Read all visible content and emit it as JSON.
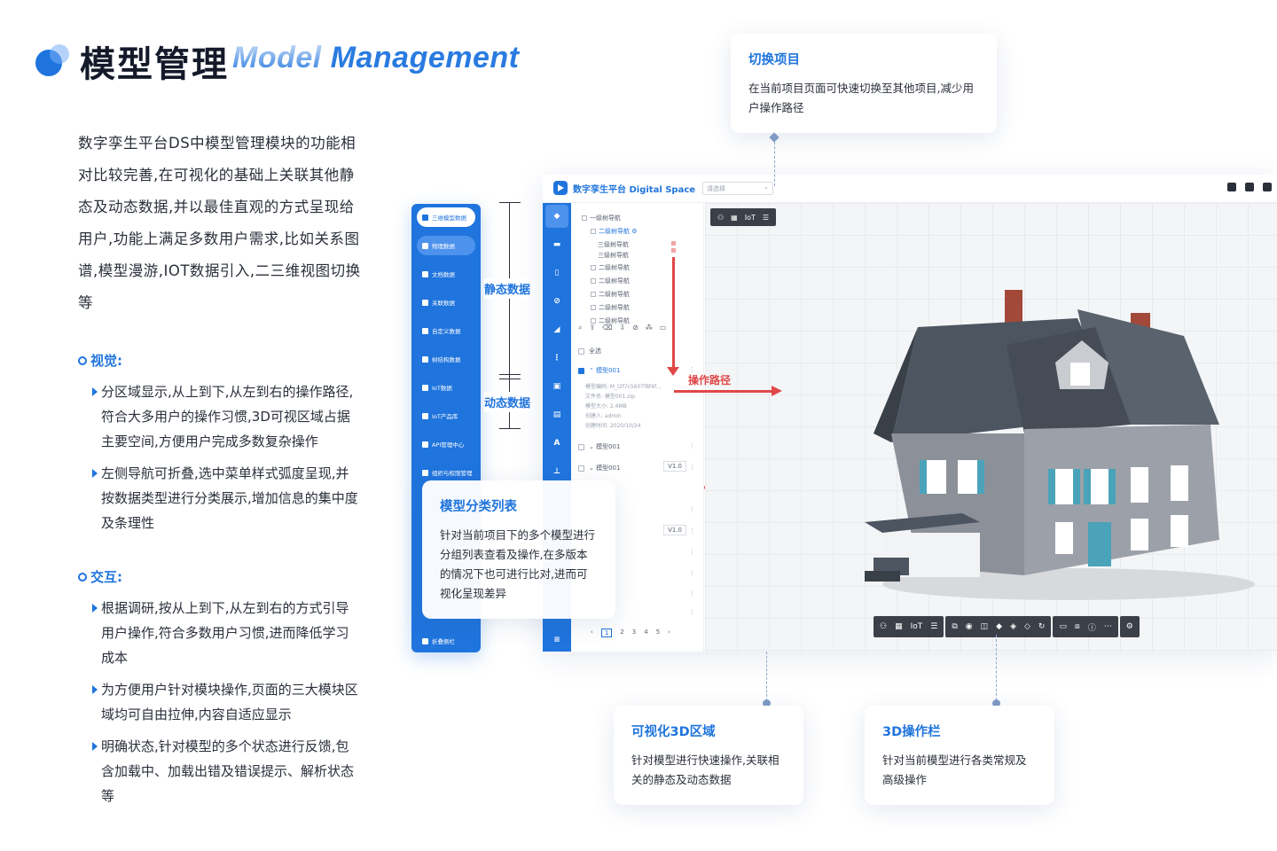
{
  "header": {
    "title_cn": "模型管理",
    "title_en_a": "Model",
    "title_en_b": " Management"
  },
  "intro": "数字孪生平台DS中模型管理模块的功能相对比较完善,在可视化的基础上关联其他静态及动态数据,并以最佳直观的方式呈现给用户,功能上满足多数用户需求,比如关系图谱,模型漫游,IOT数据引入,二三维视图切换等",
  "visual": {
    "title": "视觉:",
    "items": [
      "分区域显示,从上到下,从左到右的操作路径,符合大多用户的操作习惯,3D可视区域占据主要空间,方便用户完成多数复杂操作",
      "左侧导航可折叠,选中菜单样式弧度呈现,并按数据类型进行分类展示,增加信息的集中度及条理性"
    ]
  },
  "interaction": {
    "title": "交互:",
    "items": [
      "根据调研,按从上到下,从左到右的方式引导用户操作,符合多数用户习惯,进而降低学习成本",
      "为方便用户针对模块操作,页面的三大模块区域均可自由拉伸,内容自适应显示",
      "明确状态,针对模型的多个状态进行反馈,包含加载中、加载出错及错误提示、解析状态等"
    ]
  },
  "callouts": {
    "switch": {
      "title": "切换项目",
      "text": "在当前项目页面可快速切换至其他项目,减少用户操作路径"
    },
    "list": {
      "title": "模型分类列表",
      "text": "针对当前项目下的多个模型进行分组列表查看及操作,在多版本的情况下也可进行比对,进而可视化呈现差异"
    },
    "viz": {
      "title": "可视化3D区域",
      "text": "针对模型进行快速操作,关联相关的静态及动态数据"
    },
    "ops": {
      "title": "3D操作栏",
      "text": "针对当前模型进行各类常规及高级操作"
    }
  },
  "brackets": {
    "static": "静态数据",
    "dynamic": "动态数据"
  },
  "arrow_label": "操作路径",
  "app": {
    "brand": "数字孪生平台 Digital Space",
    "project_placeholder": "请选择",
    "sidebar": [
      "三维模型数据",
      "物理数据",
      "文档数据",
      "关联数据",
      "自定义数据",
      "树结构数据",
      "IoT数据",
      "IoT产品库",
      "API管理中心",
      "组织与权限管理"
    ],
    "collapse": "折叠侧栏",
    "tree": [
      "一级树导航",
      "二级树导航",
      "三级树导航",
      "三级树导航",
      "二级树导航",
      "二级树导航",
      "二级树导航",
      "二级树导航",
      "二级树导航"
    ],
    "select_all": "全选",
    "models": [
      {
        "name": "模型001",
        "version": ""
      },
      {
        "name": "模型001",
        "version": ""
      },
      {
        "name": "模型001",
        "version": "V1.0"
      }
    ],
    "meta": [
      "模型编码: M_l2f7c5607f8f4f...",
      "文件名: 模型001.zip",
      "模型大小: 2.4MB",
      "创建人: admin",
      "创建时间: 2020/10/24"
    ],
    "version_2": "V1.0",
    "pages": [
      "1",
      "2",
      "3",
      "4",
      "5"
    ],
    "vp_tools": [
      "IoT"
    ],
    "colors": {
      "primary": "#1f74dd",
      "arrow": "#e04848"
    }
  }
}
